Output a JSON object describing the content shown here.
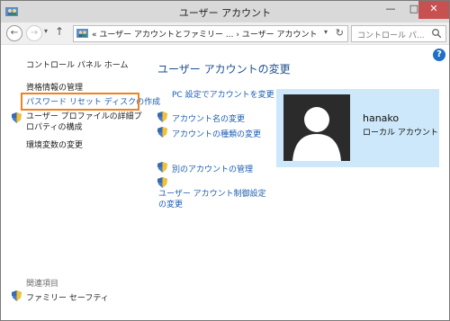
{
  "window": {
    "title": "ユーザー アカウント",
    "min": "—",
    "max": "□",
    "close": "✕"
  },
  "nav": {
    "back": "←",
    "forward": "→",
    "recent": "▾",
    "up": "↑",
    "address": "« ユーザー アカウントとファミリー ... › ユーザー アカウント",
    "address_drop": "▾",
    "refresh": "↻",
    "search_placeholder": "コントロール パ..."
  },
  "help": "?",
  "sidebar": {
    "home": "コントロール パネル ホーム",
    "items": [
      {
        "label": "資格情報の管理"
      },
      {
        "label": "パスワード リセット ディスクの作成"
      },
      {
        "label": "ユーザー プロファイルの詳細プロパティの構成"
      },
      {
        "label": "環境変数の変更"
      }
    ],
    "related_heading": "関連項目",
    "related_items": [
      {
        "label": "ファミリー セーフティ"
      }
    ]
  },
  "main": {
    "title": "ユーザー アカウントの変更",
    "links": [
      {
        "label": "PC 設定でアカウントを変更"
      },
      {
        "label": "アカウント名の変更"
      },
      {
        "label": "アカウントの種類の変更"
      },
      {
        "label": "別のアカウントの管理"
      },
      {
        "label": "ユーザー アカウント制御設定の変更"
      }
    ]
  },
  "user": {
    "name": "hanako",
    "type": "ローカル アカウント"
  },
  "colors": {
    "highlight": "#f0821c",
    "link": "#1e5db3",
    "card_bg": "#cde8fa"
  }
}
